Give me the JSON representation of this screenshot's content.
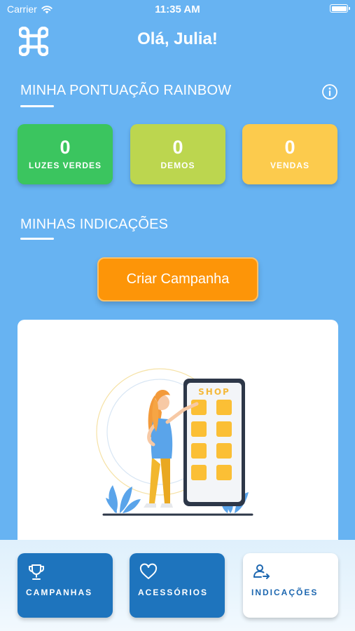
{
  "status_bar": {
    "carrier": "Carrier",
    "time": "11:35 AM"
  },
  "header": {
    "greeting": "Olá, Julia!",
    "logo_icon": "command-icon"
  },
  "score_section": {
    "title": "MINHA PONTUAÇÃO RAINBOW",
    "info_icon": "info-icon",
    "cards": [
      {
        "value": "0",
        "label": "LUZES VERDES",
        "color": "#3bc55f"
      },
      {
        "value": "0",
        "label": "DEMOS",
        "color": "#bcd64f"
      },
      {
        "value": "0",
        "label": "VENDAS",
        "color": "#fccb4d"
      }
    ]
  },
  "referrals_section": {
    "title": "MINHAS INDICAÇÕES",
    "create_button": "Criar Campanha",
    "illustration": {
      "shop_text": "SHOP"
    }
  },
  "bottom_nav": {
    "items": [
      {
        "label": "CAMPANHAS",
        "icon": "trophy-icon",
        "active": false
      },
      {
        "label": "ACESSÓRIOS",
        "icon": "heart-icon",
        "active": false
      },
      {
        "label": "INDICAÇÕES",
        "icon": "user-share-icon",
        "active": true
      }
    ]
  },
  "colors": {
    "background": "#67b3f2",
    "cta": "#fd9508",
    "nav_inactive": "#1e74bd",
    "nav_active_text": "#1d67b0"
  }
}
